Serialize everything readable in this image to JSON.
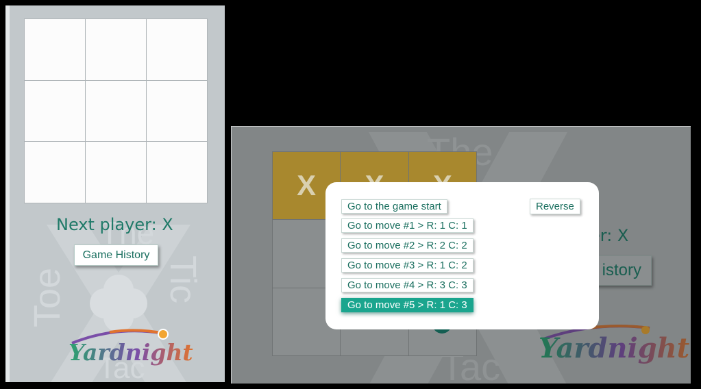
{
  "left": {
    "board": [
      "",
      "",
      "",
      "",
      "",
      "",
      "",
      "",
      ""
    ],
    "status": "Next player: X",
    "history_button": "Game History",
    "watermark": {
      "the": "The",
      "tic": "Tic",
      "tac": "Tac",
      "toe": "Toe"
    },
    "logo": "Yardnight"
  },
  "right": {
    "board": [
      "X",
      "X",
      "X",
      "",
      "",
      "",
      "",
      "",
      ""
    ],
    "status_partial": "er: X",
    "history_button_partial": "istory",
    "watermark": {
      "the": "The",
      "tac": "Tac"
    },
    "logo": "Yardnight"
  },
  "modal": {
    "start_label": "Go to the game start",
    "reverse_label": "Reverse",
    "moves": [
      "Go to move #1 > R: 1 C: 1",
      "Go to move #2 > R: 2 C: 2",
      "Go to move #3 > R: 1 C: 2",
      "Go to move #4 > R: 3 C: 3",
      "Go to move #5 > R: 1 C: 3"
    ],
    "active_index": 4
  },
  "colors": {
    "accent": "#1aa58e",
    "text_green": "#1f7a68",
    "gold": "#a8882e"
  }
}
